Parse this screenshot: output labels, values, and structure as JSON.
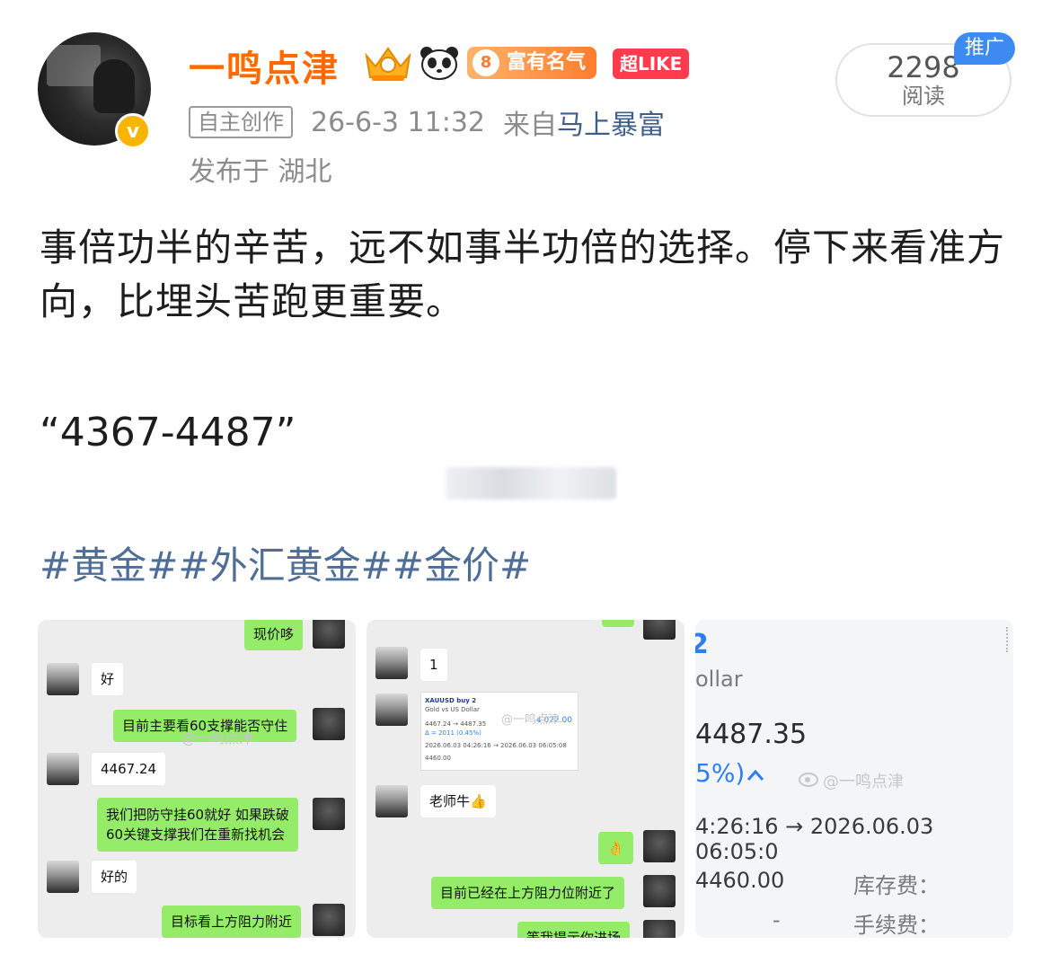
{
  "author": {
    "name": "一鸣点津",
    "level_badge_number": "8",
    "level_badge_text": "富有名气",
    "superlike": "超LIKE",
    "verified_mark": "v"
  },
  "meta": {
    "tag": "自主创作",
    "time": "26-6-3 11:32",
    "from_label": "来自",
    "source": "马上暴富",
    "location": "发布于 湖北"
  },
  "stats": {
    "read_count": "2298",
    "read_label": "阅读",
    "promo": "推广"
  },
  "post": {
    "text": "事倍功半的辛苦，远不如事半功倍的选择。停下来看准方向，比埋头苦跑更重要。",
    "quote": "“4367-4487”",
    "hashtags": "#黄金##外汇黄金##金价#"
  },
  "images": {
    "chat1": {
      "m1": "现价哆",
      "m2": "好",
      "m3": "目前主要看60支撑能否守住",
      "m4": "4467.24",
      "m5a": "我们把防守挂60就好 如果跌破",
      "m5b": "60关键支撑我们在重新找机会",
      "m6": "好的",
      "m7": "目标看上方阻力附近",
      "watermark": "@一鸣点津"
    },
    "chat2": {
      "m1": "1",
      "card_title": "XAUUSD buy 2",
      "card_sub": "Gold vs US Dollar",
      "card_price": "4467.24 → 4487.35",
      "card_change": "Δ = 2011 (0.45%)",
      "card_profit": "4 022.00",
      "card_time": "2026.06.03 04:26:16 → 2026.06.03 06:05:08",
      "card_sl": "4460.00",
      "m2": "老师牛👍",
      "m3": "👌",
      "m4": "目前已经在上方阻力位附近了",
      "m5": "等我提示你进场",
      "watermark": "@一鸣点津"
    },
    "detail": {
      "symbol_tail": "2",
      "currency_tail": "ollar",
      "price": "4487.35",
      "change": "5%)",
      "time": "4:26:16 → 2026.06.03 06:05:0",
      "sl": "4460.00",
      "swap_label": "库存费：",
      "dash": "-",
      "commission_label": "手续费：",
      "watermark": "@一鸣点津"
    }
  },
  "colors": {
    "username": "#ff6a00",
    "link": "#4e6e98",
    "wechat_green": "#95ec69"
  }
}
